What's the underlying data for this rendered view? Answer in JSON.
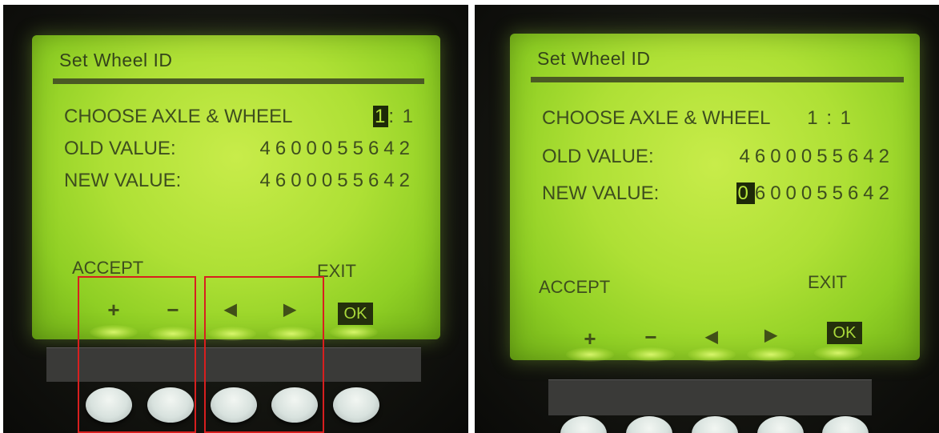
{
  "left_photo": {
    "screen_title": "Set Wheel ID",
    "choose_label": "CHOOSE AXLE & WHEEL",
    "choose_cursor": "1",
    "choose_rest": ": 1",
    "old_label": "OLD VALUE:",
    "old_value": "4600055642",
    "new_label": "NEW VALUE:",
    "new_value": "4600055642",
    "accept_label": "ACCEPT",
    "exit_label": "EXIT",
    "plus_symbol": "+",
    "minus_symbol": "−",
    "left_symbol": "◀",
    "right_symbol": "▶",
    "ok_label": "OK"
  },
  "right_photo": {
    "screen_title": "Set Wheel ID",
    "choose_label": "CHOOSE AXLE & WHEEL",
    "choose_value": "1 : 1",
    "old_label": "OLD VALUE:",
    "old_value": "4600055642",
    "new_label": "NEW VALUE:",
    "new_cursor": "0",
    "new_rest": "600055642",
    "accept_label": "ACCEPT",
    "exit_label": "EXIT",
    "plus_symbol": "+",
    "minus_symbol": "−",
    "left_symbol": "◀",
    "right_symbol": "▶",
    "ok_label": "OK"
  },
  "colors": {
    "lcd_backlight": "#b0e036",
    "lcd_text": "#3e4e1e",
    "highlight_box": "#d81f1f"
  }
}
